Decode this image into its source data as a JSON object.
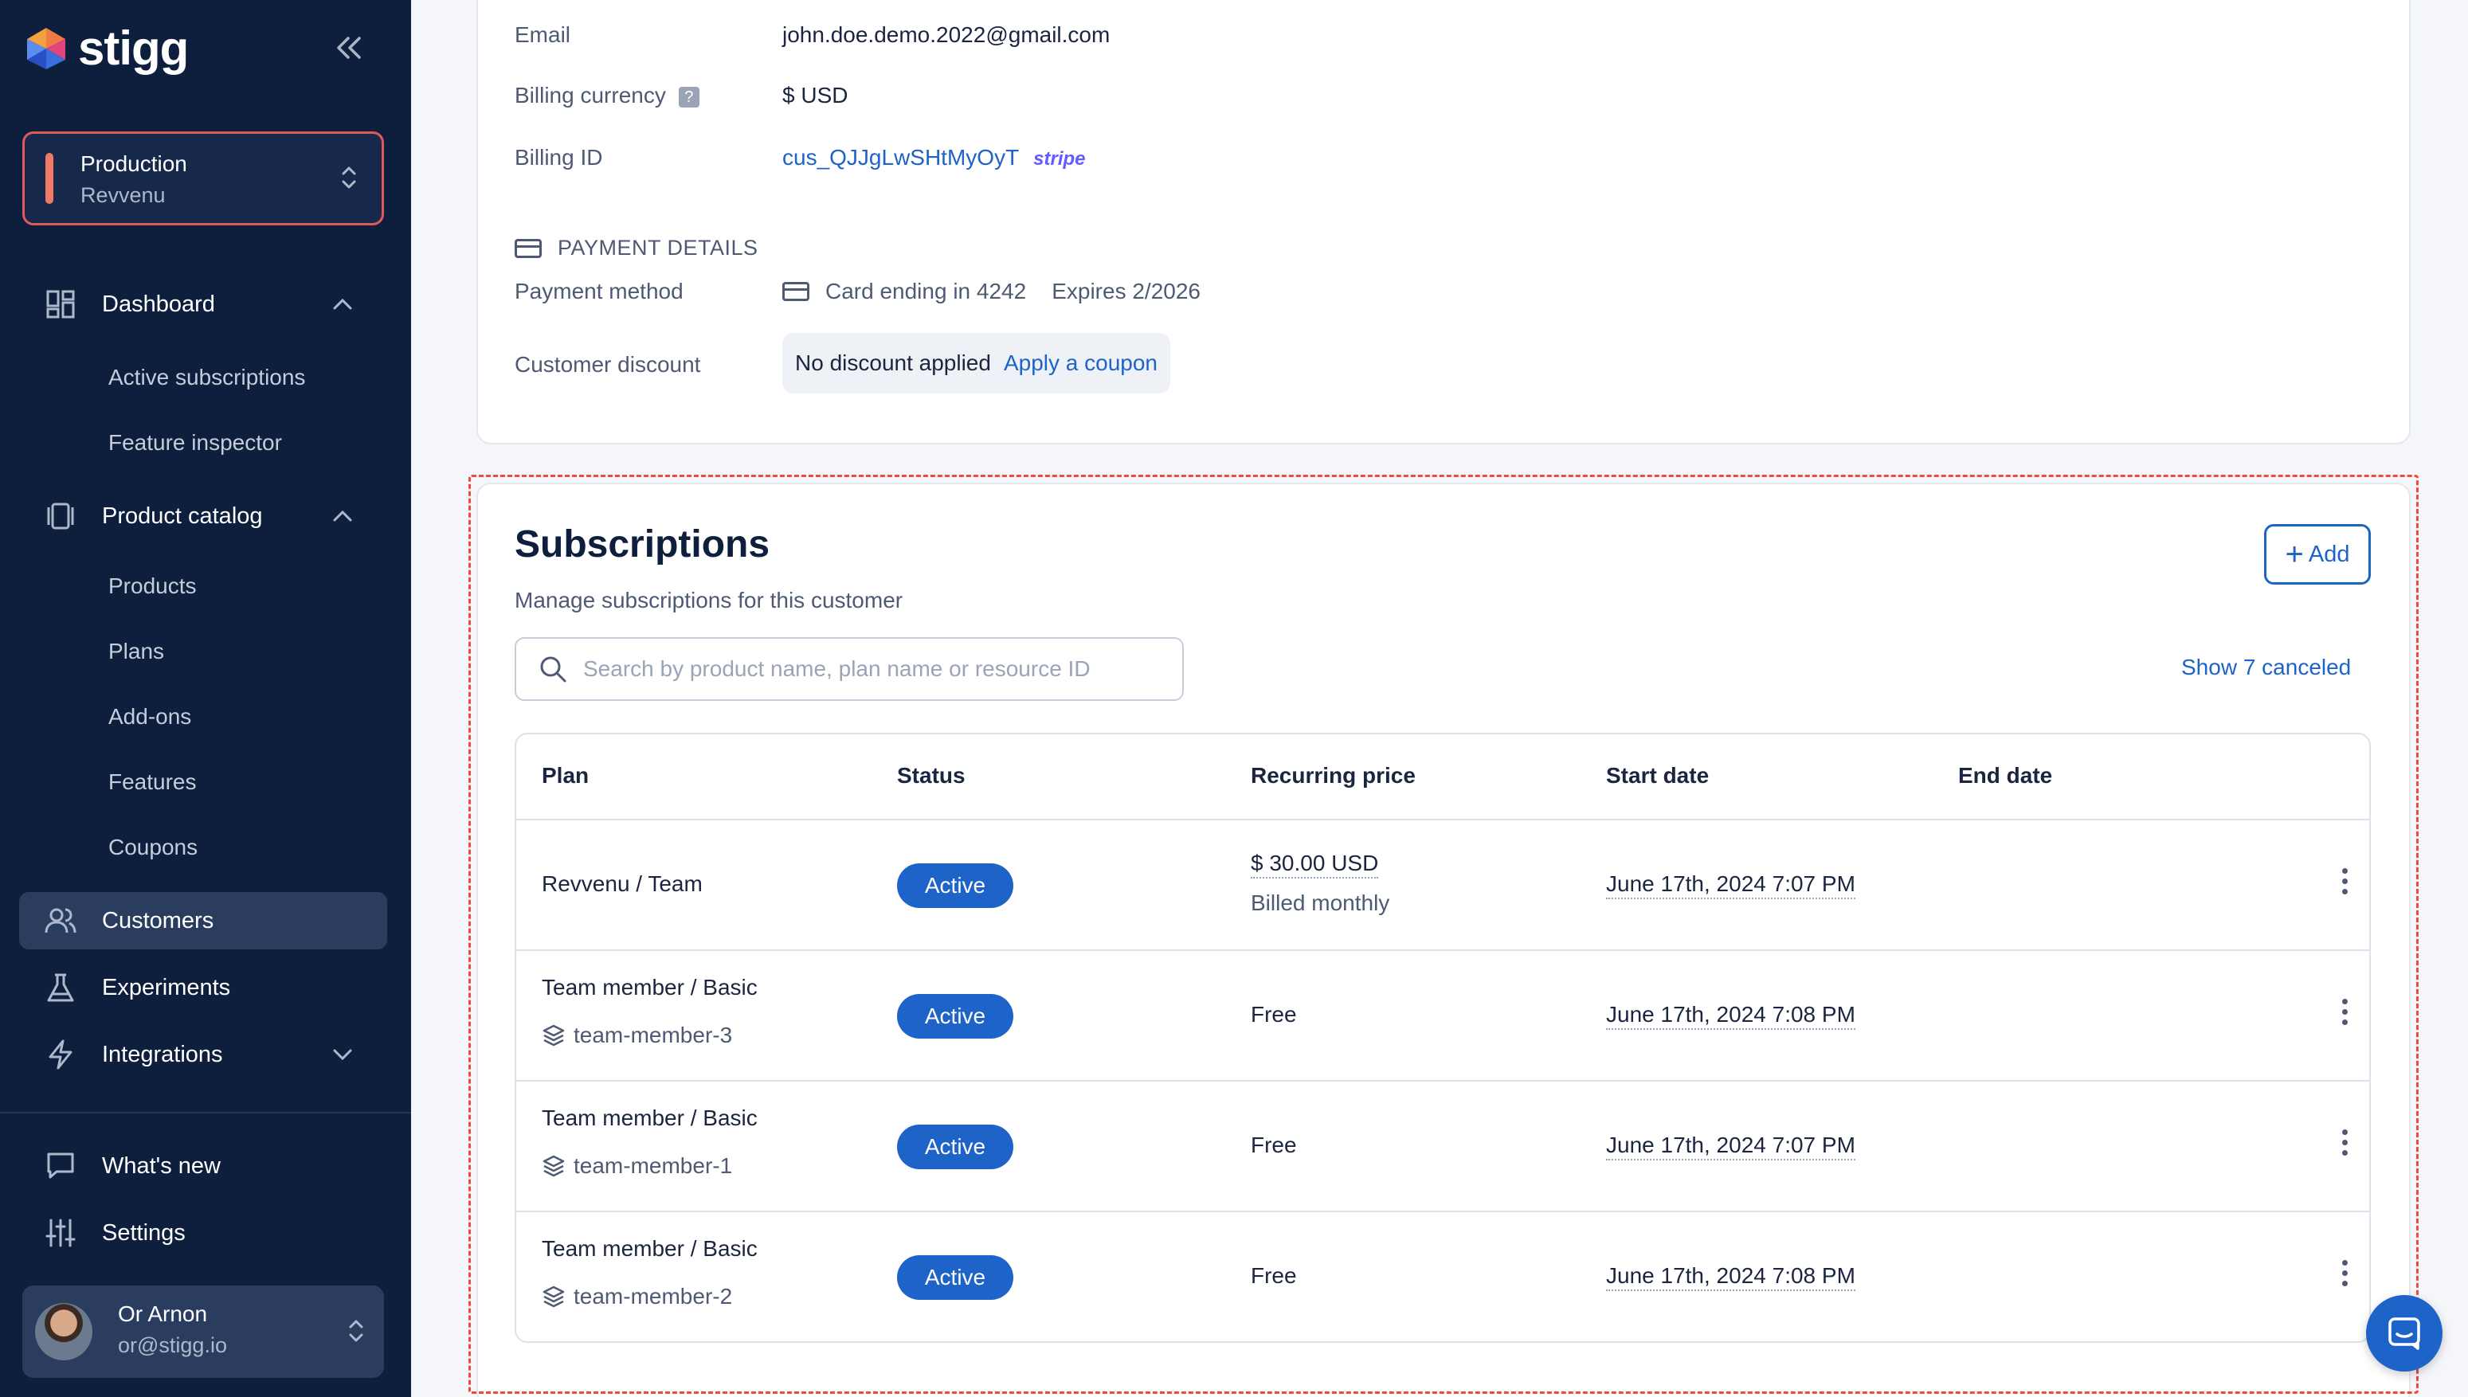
{
  "brand": {
    "name": "stigg",
    "accent": "#1e63c8",
    "sidebar_bg": "#0e1f3d"
  },
  "environment": {
    "name": "Production",
    "account": "Revvenu"
  },
  "nav": {
    "dashboard": "Dashboard",
    "active_subscriptions": "Active subscriptions",
    "feature_inspector": "Feature inspector",
    "product_catalog": "Product catalog",
    "products": "Products",
    "plans": "Plans",
    "addons": "Add-ons",
    "features": "Features",
    "coupons": "Coupons",
    "customers": "Customers",
    "experiments": "Experiments",
    "integrations": "Integrations",
    "whats_new": "What's new",
    "settings": "Settings"
  },
  "user": {
    "name": "Or Arnon",
    "email": "or@stigg.io"
  },
  "customer": {
    "email_label": "Email",
    "email": "john.doe.demo.2022@gmail.com",
    "currency_label": "Billing currency",
    "currency": "$ USD",
    "billing_id_label": "Billing ID",
    "billing_id": "cus_QJJgLwSHtMyOyT",
    "billing_provider": "stripe"
  },
  "payment": {
    "header": "PAYMENT DETAILS",
    "method_label": "Payment method",
    "card": "Card ending in 4242",
    "expires": "Expires 2/2026",
    "discount_label": "Customer discount",
    "discount_value": "No discount applied",
    "apply_coupon": "Apply a coupon"
  },
  "subscriptions": {
    "title": "Subscriptions",
    "description": "Manage subscriptions for this customer",
    "add_label": "Add",
    "search_placeholder": "Search by product name, plan name or resource ID",
    "show_canceled": "Show 7 canceled",
    "columns": [
      "Plan",
      "Status",
      "Recurring price",
      "Start date",
      "End date"
    ],
    "rows": [
      {
        "plan": "Revvenu / Team",
        "resource": "",
        "status": "Active",
        "price": "$ 30.00 USD",
        "billing": "Billed monthly",
        "start": "June 17th, 2024 7:07 PM",
        "end": ""
      },
      {
        "plan": "Team member / Basic",
        "resource": "team-member-3",
        "status": "Active",
        "price": "Free",
        "billing": "",
        "start": "June 17th, 2024 7:08 PM",
        "end": ""
      },
      {
        "plan": "Team member / Basic",
        "resource": "team-member-1",
        "status": "Active",
        "price": "Free",
        "billing": "",
        "start": "June 17th, 2024 7:07 PM",
        "end": ""
      },
      {
        "plan": "Team member / Basic",
        "resource": "team-member-2",
        "status": "Active",
        "price": "Free",
        "billing": "",
        "start": "June 17th, 2024 7:08 PM",
        "end": ""
      }
    ]
  }
}
